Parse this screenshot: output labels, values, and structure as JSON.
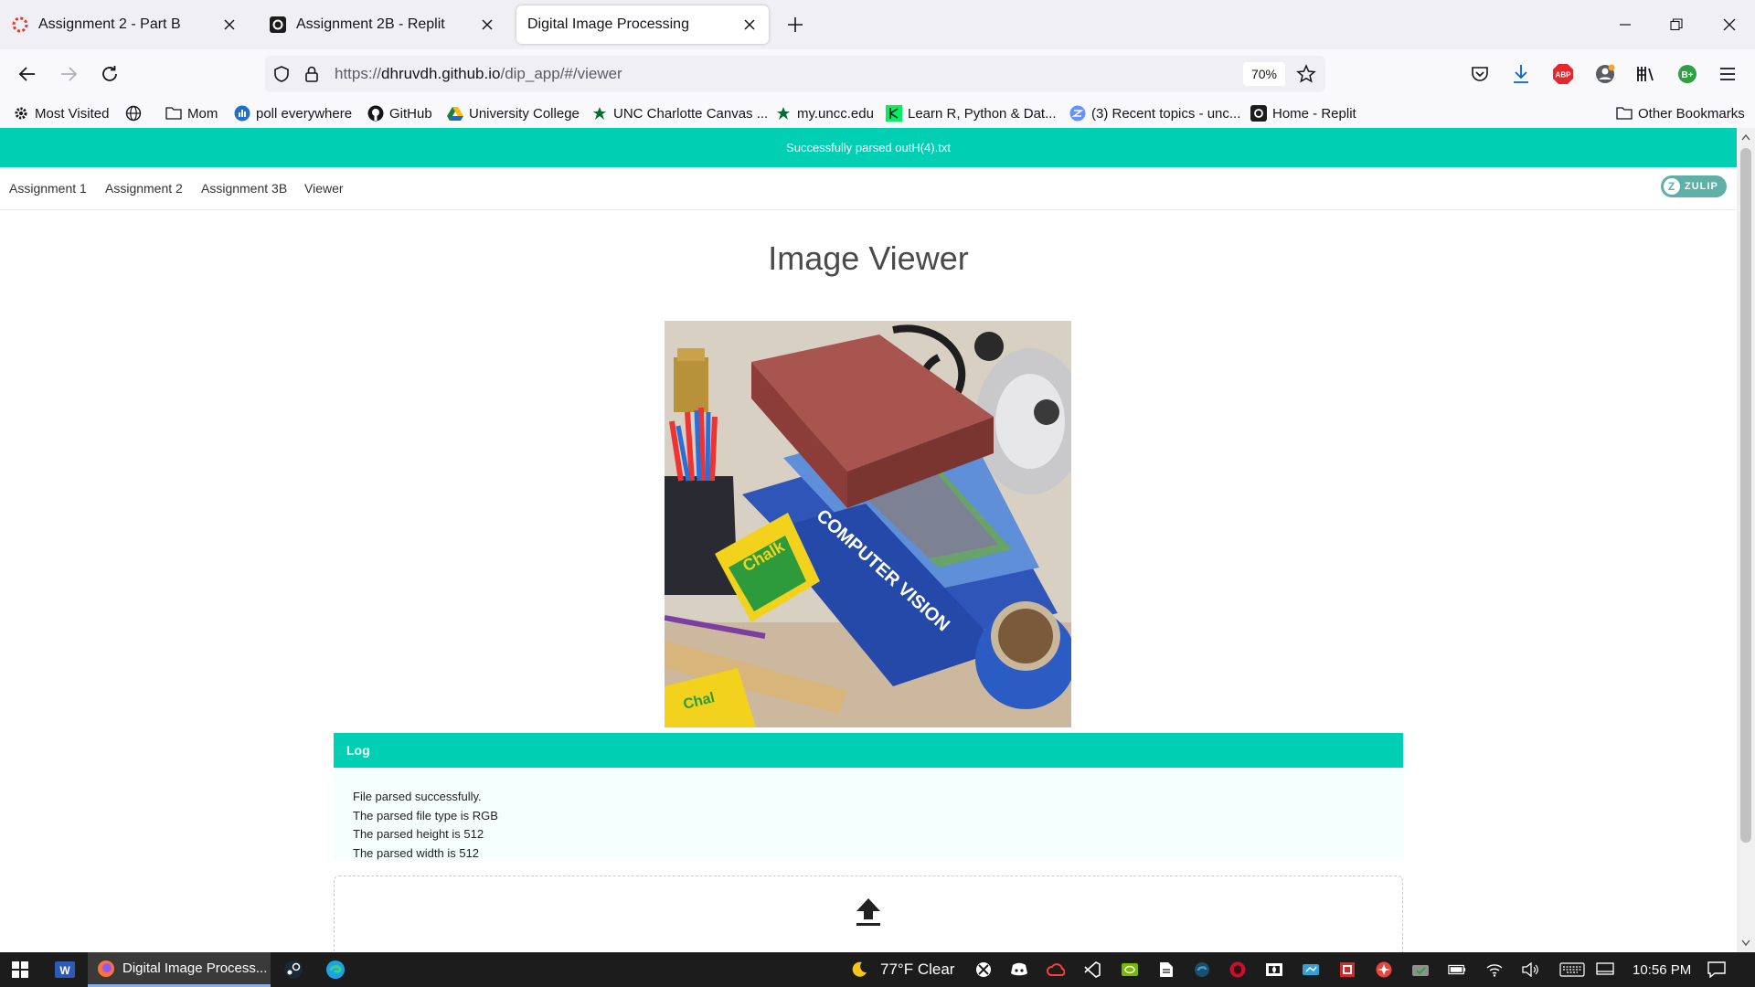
{
  "browser": {
    "tabs": [
      {
        "title": "Assignment 2 - Part B",
        "icon": "canvas-icon"
      },
      {
        "title": "Assignment 2B - Replit",
        "icon": "replit-icon"
      },
      {
        "title": "Digital Image Processing",
        "icon": "none",
        "active": true
      }
    ],
    "url_prefix": "https://",
    "url_host": "dhruvdh.github.io",
    "url_path": "/dip_app/#/viewer",
    "zoom": "70%",
    "bookmarks": [
      "Most Visited",
      "Mom",
      "poll everywhere",
      "GitHub",
      "University College",
      "UNC Charlotte Canvas ...",
      "my.uncc.edu",
      "Learn R, Python & Dat...",
      "(3) Recent topics - unc...",
      "Home - Replit"
    ],
    "other_bookmarks": "Other Bookmarks"
  },
  "page": {
    "banner": "Successfully parsed outH(4).txt",
    "menu": [
      "Assignment 1",
      "Assignment 2",
      "Assignment 3B",
      "Viewer"
    ],
    "zulip": "ZULIP",
    "title": "Image Viewer",
    "log": {
      "title": "Log",
      "lines": [
        "File parsed successfully.",
        "The parsed file type is RGB",
        "The parsed height is 512",
        "The parsed width is 512"
      ]
    },
    "upload_icon": "upload-icon"
  },
  "taskbar": {
    "active_app": "Digital Image Process...",
    "weather": "77°F  Clear",
    "time": "10:56 PM"
  },
  "colors": {
    "accent": "#00cfb4",
    "tabbar": "#f0f0f4",
    "taskbar": "#1c1c1c"
  }
}
